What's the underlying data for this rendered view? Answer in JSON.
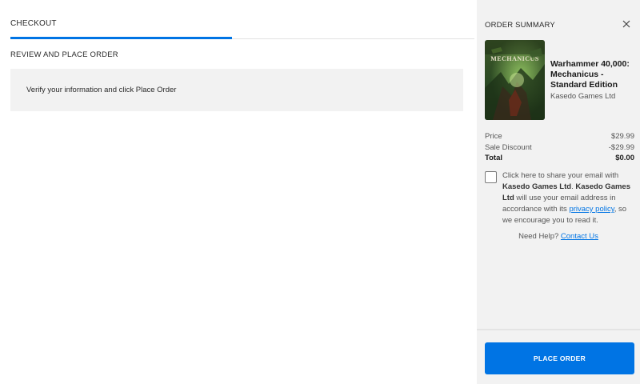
{
  "checkout": {
    "tab_title": "CHECKOUT",
    "section_title": "REVIEW AND PLACE ORDER",
    "info_message": "Verify your information and click Place Order"
  },
  "summary": {
    "title": "ORDER SUMMARY",
    "close_icon": "close-icon",
    "product": {
      "cover_text": "MECHANICUS",
      "title": "Warhammer 40,000: Mechanicus - Standard Edition",
      "publisher": "Kasedo Games Ltd"
    },
    "price_label": "Price",
    "price_value": "$29.99",
    "discount_label": "Sale Discount",
    "discount_value": "-$29.99",
    "total_label": "Total",
    "total_value": "$0.00",
    "consent": {
      "part1": "Click here to share your email with ",
      "bold1": "Kasedo Games Ltd",
      "part2": ". ",
      "bold2": "Kasedo Games Ltd",
      "part3": " will use your email address in accordance with its ",
      "link": "privacy policy",
      "part4": ", so we encourage you to read it."
    },
    "help_text": "Need Help?",
    "help_link": "Contact Us",
    "place_order": "PLACE ORDER"
  },
  "colors": {
    "accent": "#0074e4",
    "panel_bg": "#f2f2f2"
  }
}
